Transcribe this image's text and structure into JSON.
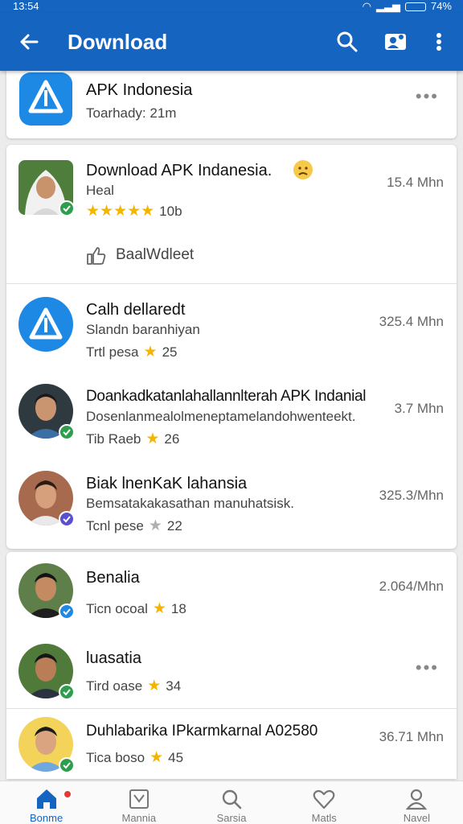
{
  "status": {
    "time": "13:54",
    "battery": "74%"
  },
  "appbar": {
    "title": "Download"
  },
  "top_card": {
    "title": "APK Indonesia",
    "subtitle": "Toarhady: 21m"
  },
  "featured": {
    "title": "Download APK Indanesia.",
    "subtitle": "Heal",
    "rating_count": "10b",
    "size": "15.4 Mhn",
    "stars": 4.5,
    "action_label": "BaalWdleet"
  },
  "list1": [
    {
      "title": "Calh dellaredt",
      "subtitle": "Slandn  baranhiyan",
      "meta": "Trtl pesa",
      "rating": "25",
      "size": "325.4 Mhn",
      "avatar": "app"
    },
    {
      "title": "Doankadkatanlahallannlterah APK Indanial",
      "subtitle": "Dosenlanmealolmeneptamelandohwenteekt.",
      "meta": "Tib Raeb",
      "rating": "26",
      "size": "3.7 Mhn",
      "avatar": "man1"
    },
    {
      "title": "Biak lnenKaK lahansia",
      "subtitle": "Bemsatakakasathan manuhatsisk.",
      "meta": "Tcnl pese",
      "rating": "22",
      "size": "325.3/Mhn",
      "avatar": "man2"
    }
  ],
  "list2": [
    {
      "title": "Benalia",
      "meta": "Ticn ocoal",
      "rating": "18",
      "size": "2.064/Mhn",
      "avatar": "man3"
    },
    {
      "title": "luasatia",
      "meta": "Tird oase",
      "rating": "34",
      "size": "",
      "avatar": "man4"
    },
    {
      "title": "Duhlabarika IPkarmkarnal A02580",
      "meta": "Tica boso",
      "rating": "45",
      "size": "36.71 Mhn",
      "avatar": "man5"
    }
  ],
  "bottom_nav": [
    {
      "label": "Bonme",
      "icon": "home-icon"
    },
    {
      "label": "Mannia",
      "icon": "inbox-icon"
    },
    {
      "label": "Sarsia",
      "icon": "search-icon"
    },
    {
      "label": "Matls",
      "icon": "heart-icon"
    },
    {
      "label": "Navel",
      "icon": "profile-icon"
    }
  ],
  "colors": {
    "primary": "#1565c0",
    "accent": "#1e88e5",
    "star": "#f4b400",
    "verified": "#2e9e4e"
  }
}
